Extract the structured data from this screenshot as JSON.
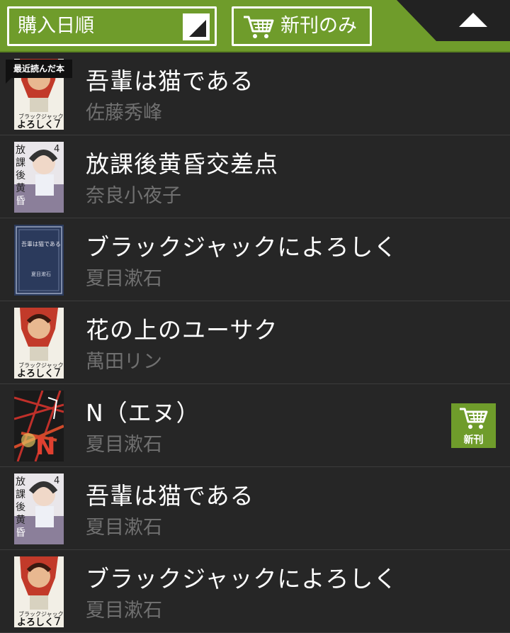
{
  "toolbar": {
    "sort_label": "購入日順",
    "new_only_label": "新刊のみ",
    "accent_color": "#6f9c2b"
  },
  "books": [
    {
      "title": "吾輩は猫である",
      "author": "佐藤秀峰",
      "recent_badge": "最近読んだ本",
      "cover": "manga-cover-red"
    },
    {
      "title": "放課後黄昏交差点",
      "author": "奈良小夜子",
      "cover": "manga-cover-student"
    },
    {
      "title": "ブラックジャックによろしく",
      "author": "夏目漱石",
      "cover": "novel-cover-blue"
    },
    {
      "title": "花の上のユーサク",
      "author": "萬田リン",
      "cover": "manga-cover-red"
    },
    {
      "title": "N（エヌ）",
      "author": "夏目漱石",
      "cover": "manga-cover-dark",
      "new_badge": "新刊"
    },
    {
      "title": "吾輩は猫である",
      "author": "夏目漱石",
      "cover": "manga-cover-student"
    },
    {
      "title": "ブラックジャックによろしく",
      "author": "夏目漱石",
      "cover": "manga-cover-red"
    }
  ]
}
